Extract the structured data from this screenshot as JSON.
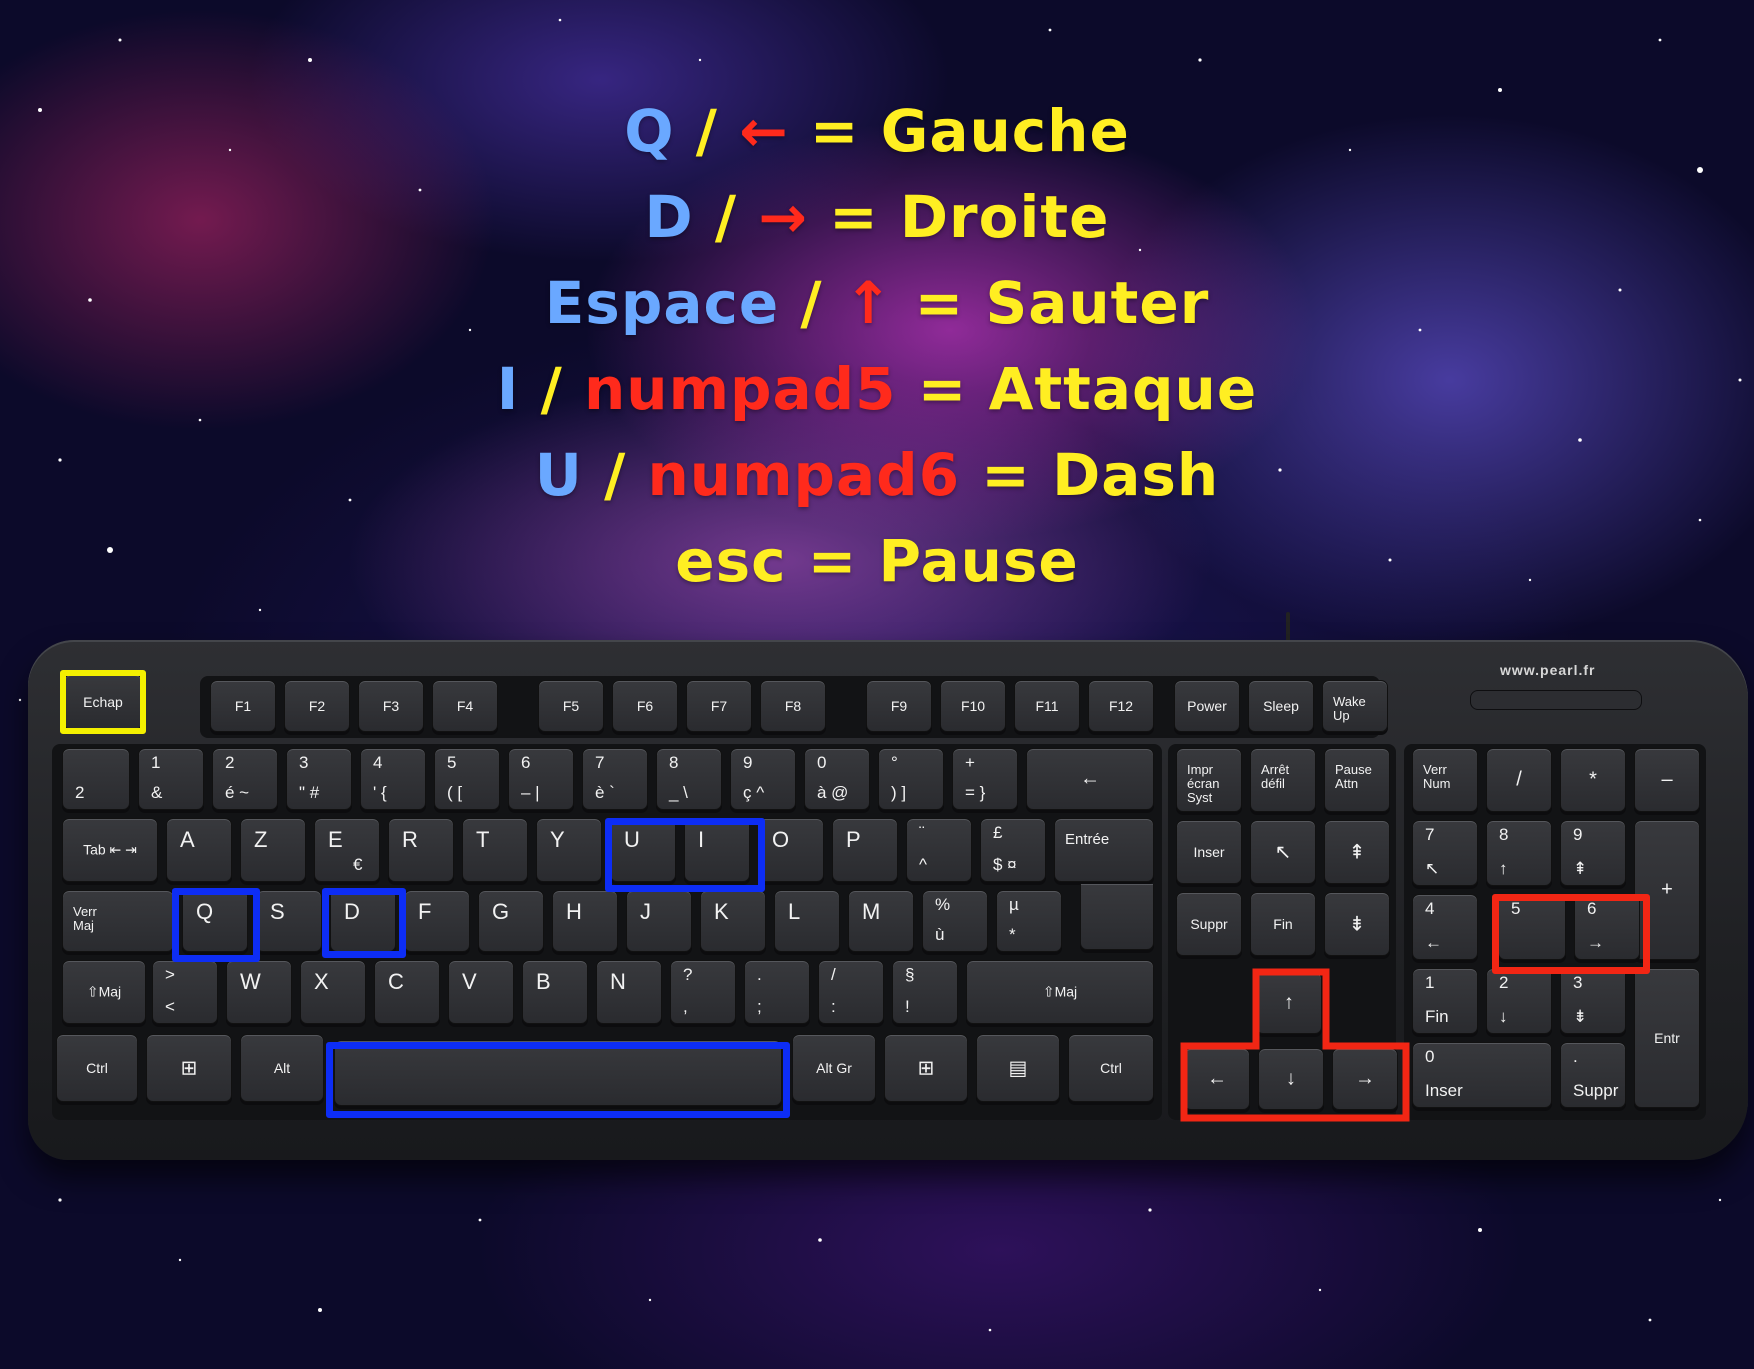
{
  "controls": [
    {
      "key": "Q",
      "alt": "←",
      "action": "Gauche"
    },
    {
      "key": "D",
      "alt": "→",
      "action": "Droite"
    },
    {
      "key": "Espace",
      "alt": "↑",
      "action": "Sauter"
    },
    {
      "key": "I",
      "alt": "numpad5",
      "action": "Attaque"
    },
    {
      "key": "U",
      "alt": "numpad6",
      "action": "Dash"
    },
    {
      "key": "esc",
      "action": "Pause"
    }
  ],
  "separators": {
    "slash": "/",
    "equals": "="
  },
  "colors": {
    "key": "#6aa8ff",
    "alt": "#ff2a1c",
    "action": "#ffee22",
    "highlight_blue": "#0d2df5",
    "highlight_red": "#f22614",
    "highlight_yellow": "#f4f000"
  },
  "keyboard": {
    "brand": "www.pearl.fr",
    "function_row": {
      "esc": "Echap",
      "f": [
        "F1",
        "F2",
        "F3",
        "F4",
        "F5",
        "F6",
        "F7",
        "F8",
        "F9",
        "F10",
        "F11",
        "F12"
      ],
      "power": "Power",
      "sleep": "Sleep",
      "wake": "Wake Up"
    },
    "number_row": {
      "first": "2",
      "keys": [
        [
          "1",
          "&"
        ],
        [
          "2",
          "é ~"
        ],
        [
          "3",
          "\" #"
        ],
        [
          "4",
          "' {"
        ],
        [
          "5",
          "( ["
        ],
        [
          "6",
          "– |"
        ],
        [
          "7",
          "è `"
        ],
        [
          "8",
          "_ \\"
        ],
        [
          "9",
          "ç ^"
        ],
        [
          "0",
          "à @"
        ],
        [
          "°",
          ") ]"
        ],
        [
          "+",
          "= }"
        ]
      ],
      "backspace": "←"
    },
    "row_q": {
      "tab": "Tab ⇤ ⇥",
      "keys": [
        "A",
        "Z",
        "E",
        "R",
        "T",
        "Y",
        "U",
        "I",
        "O",
        "P"
      ],
      "e_alt": "€",
      "trema": [
        "¨",
        "^"
      ],
      "pound": [
        "£",
        "$ ¤"
      ],
      "enter": "Entrée"
    },
    "row_home": {
      "caps": "Verr Maj",
      "keys": [
        "Q",
        "S",
        "D",
        "F",
        "G",
        "H",
        "J",
        "K",
        "L",
        "M"
      ],
      "percent": [
        "%",
        "ù"
      ],
      "mu": [
        "µ",
        "*"
      ]
    },
    "row_shift": {
      "lshift": "⇧Maj",
      "angle": [
        ">",
        "<"
      ],
      "keys": [
        "W",
        "X",
        "C",
        "V",
        "B",
        "N"
      ],
      "q1": [
        "?",
        ","
      ],
      "q2": [
        ".",
        ";"
      ],
      "q3": [
        "/",
        ":"
      ],
      "q4": [
        "§",
        "!"
      ],
      "rshift": "⇧Maj"
    },
    "row_bottom": {
      "ctrl": "Ctrl",
      "win": "⊞",
      "alt": "Alt",
      "altgr": "Alt Gr",
      "menu": "▤",
      "rctrl": "Ctrl"
    },
    "nav": {
      "print": "Impr écran Syst",
      "scroll": "Arrêt défil",
      "pause": "Pause Attn",
      "insert": "Inser",
      "home": "↖",
      "pgup": "⇞",
      "delete": "Suppr",
      "end": "Fin",
      "pgdn": "⇟"
    },
    "arrows": {
      "up": "↑",
      "left": "←",
      "down": "↓",
      "right": "→"
    },
    "numpad": {
      "num": "Verr Num",
      "div": "/",
      "mul": "*",
      "minus": "–",
      "plus": "+",
      "enter": "Entr",
      "n7": [
        "7",
        "↖"
      ],
      "n8": [
        "8",
        "↑"
      ],
      "n9": [
        "9",
        "⇞"
      ],
      "n4": [
        "4",
        "←"
      ],
      "n5": [
        "5",
        ""
      ],
      "n6": [
        "6",
        "→"
      ],
      "n1": [
        "1",
        "Fin"
      ],
      "n2": [
        "2",
        "↓"
      ],
      "n3": [
        "3",
        "⇟"
      ],
      "n0": [
        "0",
        "Inser"
      ],
      "dot": [
        ".",
        "Suppr"
      ]
    }
  }
}
